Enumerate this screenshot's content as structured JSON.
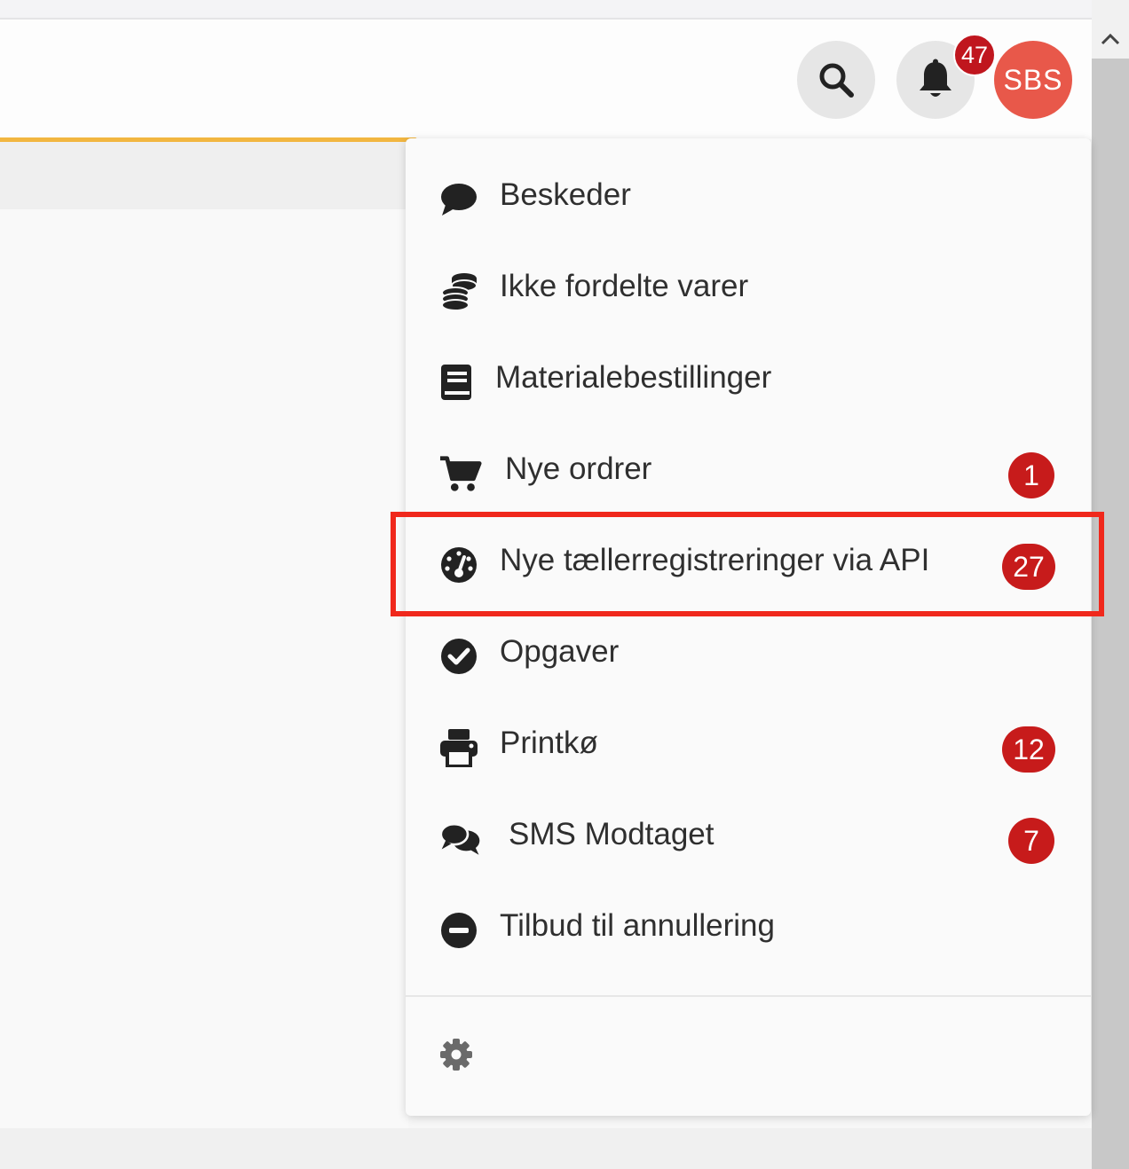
{
  "header": {
    "avatar_initials": "SBS",
    "notification_count": "47",
    "accent_color": "#f2b640",
    "avatar_color": "#e8584a",
    "badge_color": "#c71b1b"
  },
  "icons": {
    "search": "search-icon",
    "bell": "bell-icon",
    "scroll_up": "chevron-up-icon",
    "settings": "gear-icon"
  },
  "menu": {
    "items": [
      {
        "label": "Beskeder",
        "icon": "comment-icon",
        "count": ""
      },
      {
        "label": "Ikke fordelte varer",
        "icon": "coins-icon",
        "count": ""
      },
      {
        "label": "Materialebestillinger",
        "icon": "book-icon",
        "count": ""
      },
      {
        "label": "Nye ordrer",
        "icon": "cart-icon",
        "count": "1"
      },
      {
        "label": "Nye tællerregistreringer via API",
        "icon": "gauge-icon",
        "count": "27",
        "highlighted": true
      },
      {
        "label": "Opgaver",
        "icon": "check-circle-icon",
        "count": ""
      },
      {
        "label": "Printkø",
        "icon": "printer-icon",
        "count": "12"
      },
      {
        "label": "SMS Modtaget",
        "icon": "comments-icon",
        "count": "7"
      },
      {
        "label": "Tilbud til annullering",
        "icon": "minus-circle-icon",
        "count": ""
      }
    ]
  },
  "highlight_color": "#f0281c"
}
